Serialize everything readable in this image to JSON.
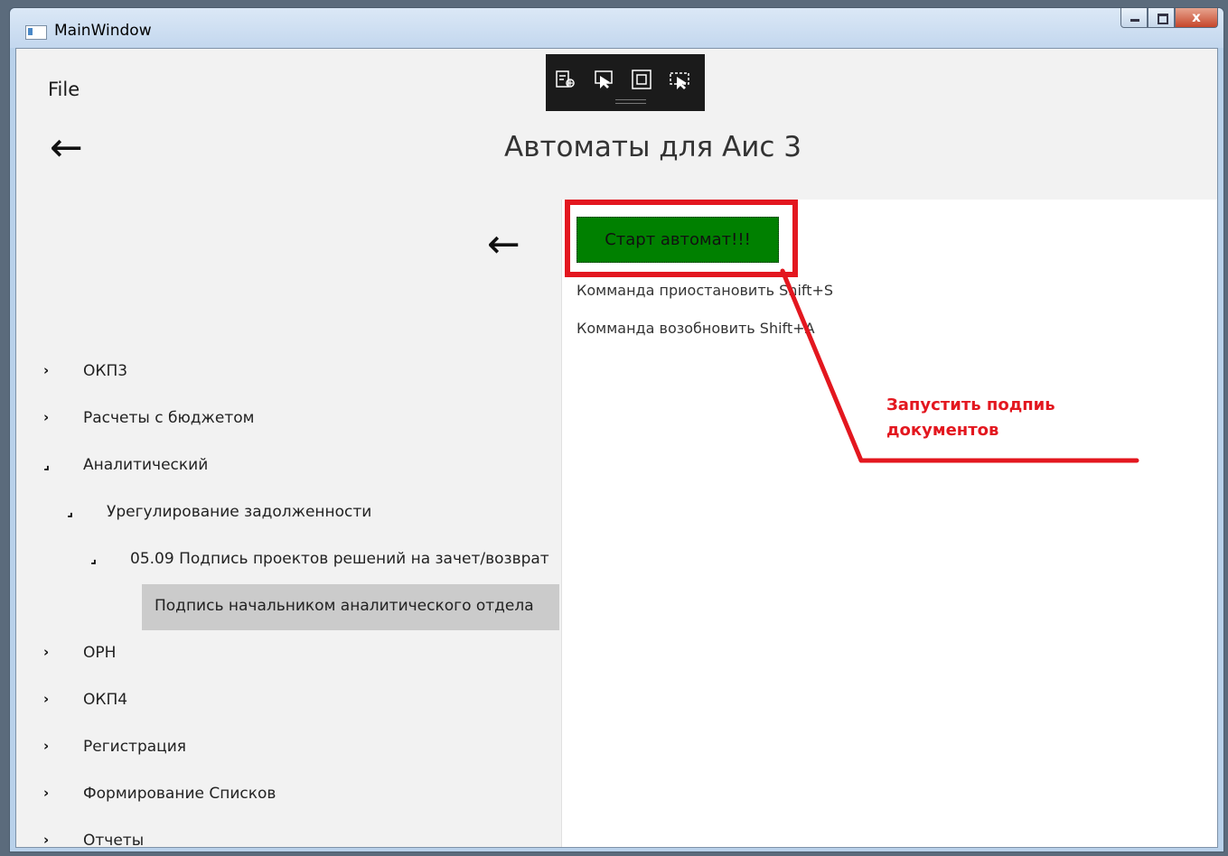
{
  "window": {
    "title": "MainWindow",
    "close_glyph": "x"
  },
  "menu": {
    "file_label": "File"
  },
  "header": {
    "title": "Автоматы для Аис 3",
    "back_glyph": "←"
  },
  "debug_toolbar": {
    "icons": [
      "select-element-icon",
      "track-focus-icon",
      "display-adorners-icon",
      "hot-reload-icon"
    ]
  },
  "tree": {
    "back_glyph": "←",
    "items": [
      {
        "label": "ОКП3",
        "arrow": "›"
      },
      {
        "label": "Расчеты с бюджетом",
        "arrow": "›"
      },
      {
        "label": "Аналитический",
        "arrow": "⌟"
      },
      {
        "label": "Урегулирование задолженности",
        "arrow": "⌟"
      },
      {
        "label": "05.09 Подпись проектов решений на зачет/возврат",
        "arrow": "⌟"
      },
      {
        "label": "Подпись начальником аналитического отдела",
        "arrow": ""
      },
      {
        "label": "ОРН",
        "arrow": "›"
      },
      {
        "label": "ОКП4",
        "arrow": "›"
      },
      {
        "label": "Регистрация",
        "arrow": "›"
      },
      {
        "label": "Формирование Списков",
        "arrow": "›"
      },
      {
        "label": "Отчеты",
        "arrow": "›"
      }
    ]
  },
  "automation": {
    "start_label": "Старт автомат!!!",
    "pause_hint": "Комманда приостановить Shift+S",
    "resume_hint": "Комманда возобновить Shift+A"
  },
  "annotation": {
    "line1": "Запустить подпиь",
    "line2": "документов",
    "color": "#e3171f"
  }
}
